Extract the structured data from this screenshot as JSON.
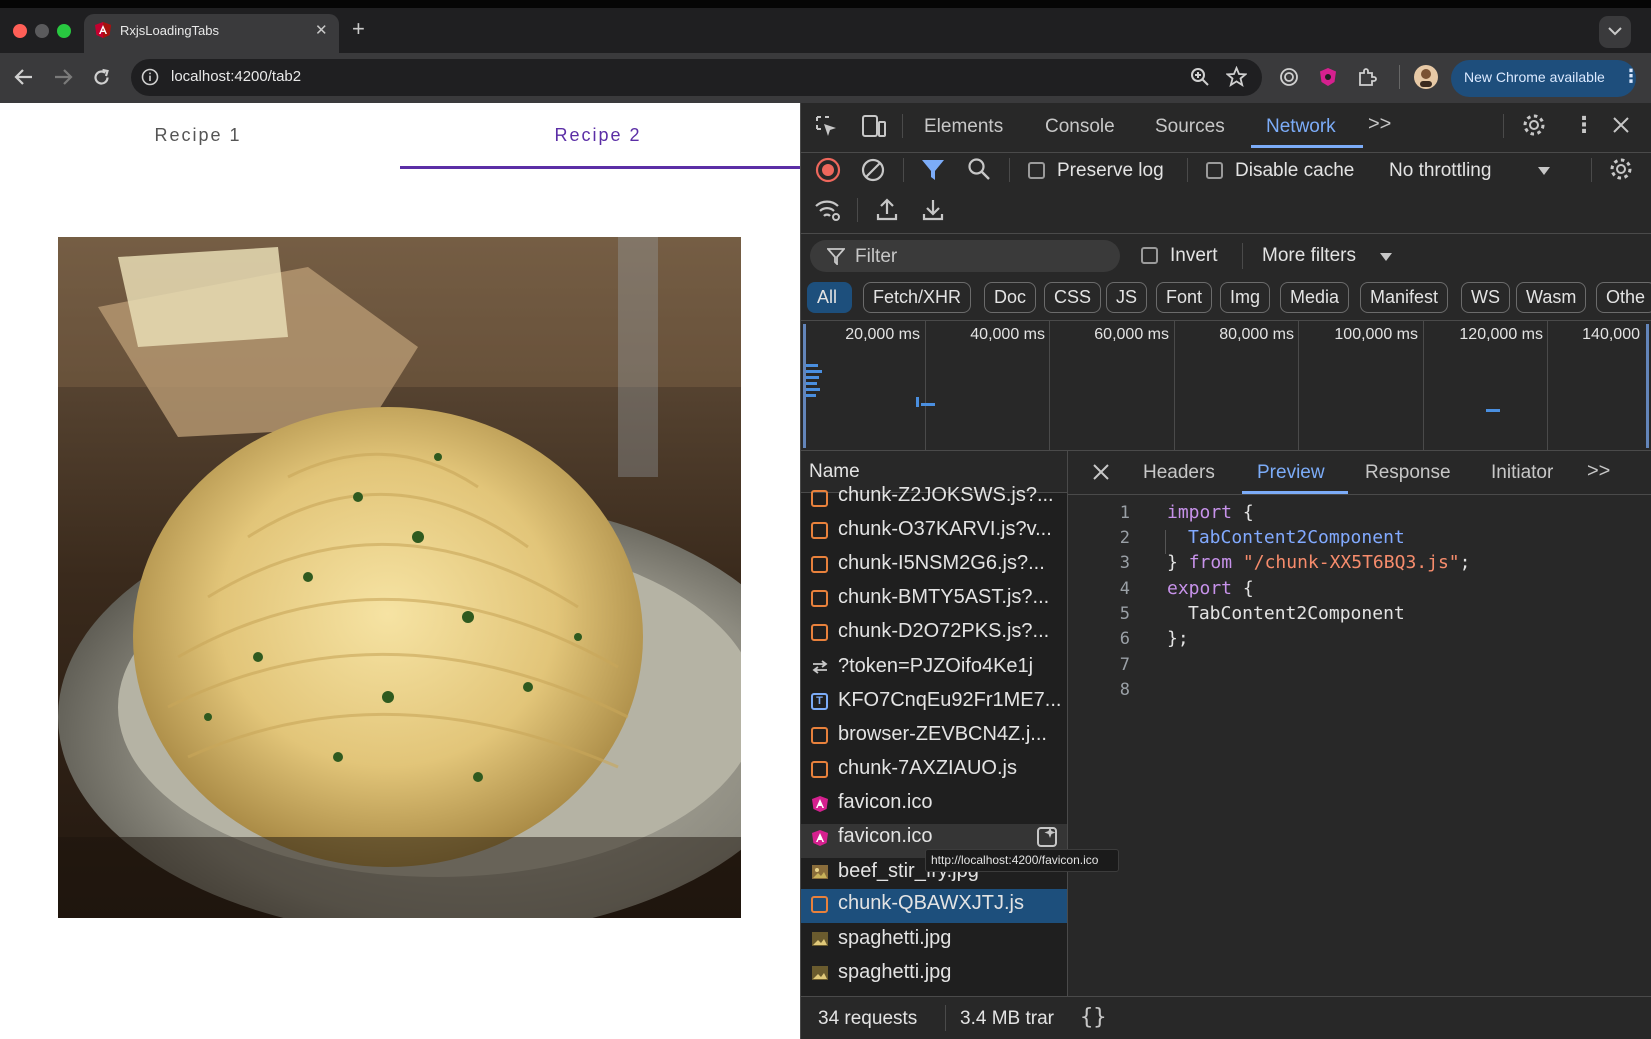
{
  "browser": {
    "tab_title": "RxjsLoadingTabs",
    "new_tab": "+",
    "url": "localhost:4200/tab2",
    "update_label": "New Chrome available"
  },
  "page": {
    "tabs": [
      {
        "label": "Recipe 1"
      },
      {
        "label": "Recipe 2"
      }
    ],
    "active_tab": 1
  },
  "devtools": {
    "tabs": [
      "Elements",
      "Console",
      "Sources",
      "Network"
    ],
    "active_tab": "Network",
    "more": ">>",
    "preserve_log": "Preserve log",
    "disable_cache": "Disable cache",
    "throttling": "No throttling",
    "filter_placeholder": "Filter",
    "invert": "Invert",
    "more_filters": "More filters",
    "type_chips": [
      "All",
      "Fetch/XHR",
      "Doc",
      "CSS",
      "JS",
      "Font",
      "Img",
      "Media",
      "Manifest",
      "WS",
      "Wasm",
      "Othe"
    ],
    "timeline_ticks": [
      "20,000 ms",
      "40,000 ms",
      "60,000 ms",
      "80,000 ms",
      "100,000 ms",
      "120,000 ms",
      "140,000"
    ],
    "name_header": "Name",
    "requests": [
      {
        "name": "chunk-Z2JOKSWS.js?...",
        "kind": "script"
      },
      {
        "name": "chunk-O37KARVI.js?v...",
        "kind": "script"
      },
      {
        "name": "chunk-I5NSM2G6.js?...",
        "kind": "script"
      },
      {
        "name": "chunk-BMTY5AST.js?...",
        "kind": "script"
      },
      {
        "name": "chunk-D2O72PKS.js?...",
        "kind": "script"
      },
      {
        "name": "?token=PJZOifo4Ke1j",
        "kind": "websocket"
      },
      {
        "name": "KFO7CnqEu92Fr1ME7...",
        "kind": "font"
      },
      {
        "name": "browser-ZEVBCN4Z.j...",
        "kind": "script"
      },
      {
        "name": "chunk-7AXZIAUO.js",
        "kind": "script"
      },
      {
        "name": "favicon.ico",
        "kind": "favicon"
      },
      {
        "name": "favicon.ico",
        "kind": "favicon"
      },
      {
        "name": "beef_stir_fry.jpg",
        "kind": "image"
      },
      {
        "name": "chunk-QBAWXJTJ.js",
        "kind": "script"
      },
      {
        "name": "spaghetti.jpg",
        "kind": "image"
      },
      {
        "name": "spaghetti.jpg",
        "kind": "image"
      }
    ],
    "hovered_row": 10,
    "selected_row": 12,
    "tooltip": "http://localhost:4200/favicon.ico",
    "detail_tabs": [
      "Headers",
      "Preview",
      "Response",
      "Initiator"
    ],
    "active_detail_tab": "Preview",
    "line_numbers": [
      "1",
      "2",
      "3",
      "4",
      "5",
      "6",
      "7",
      "8"
    ],
    "code": {
      "l1_kw": "import",
      "l1_p": " {",
      "l2": "TabContent2Component",
      "l3_p": "} ",
      "l3_kw": "from",
      "l3_s": "\"/chunk-XX5T6BQ3.js\"",
      "l3_end": ";",
      "l4_kw": "export",
      "l4_p": " {",
      "l5": "TabContent2Component",
      "l6": "};"
    },
    "status_requests": "34 requests",
    "status_transfer": "3.4 MB trar",
    "format_button": "{}"
  },
  "colors": {
    "accent": "#5b2ea6",
    "devtools_blue": "#7cacf8",
    "selected_row": "#1d4f7c"
  }
}
